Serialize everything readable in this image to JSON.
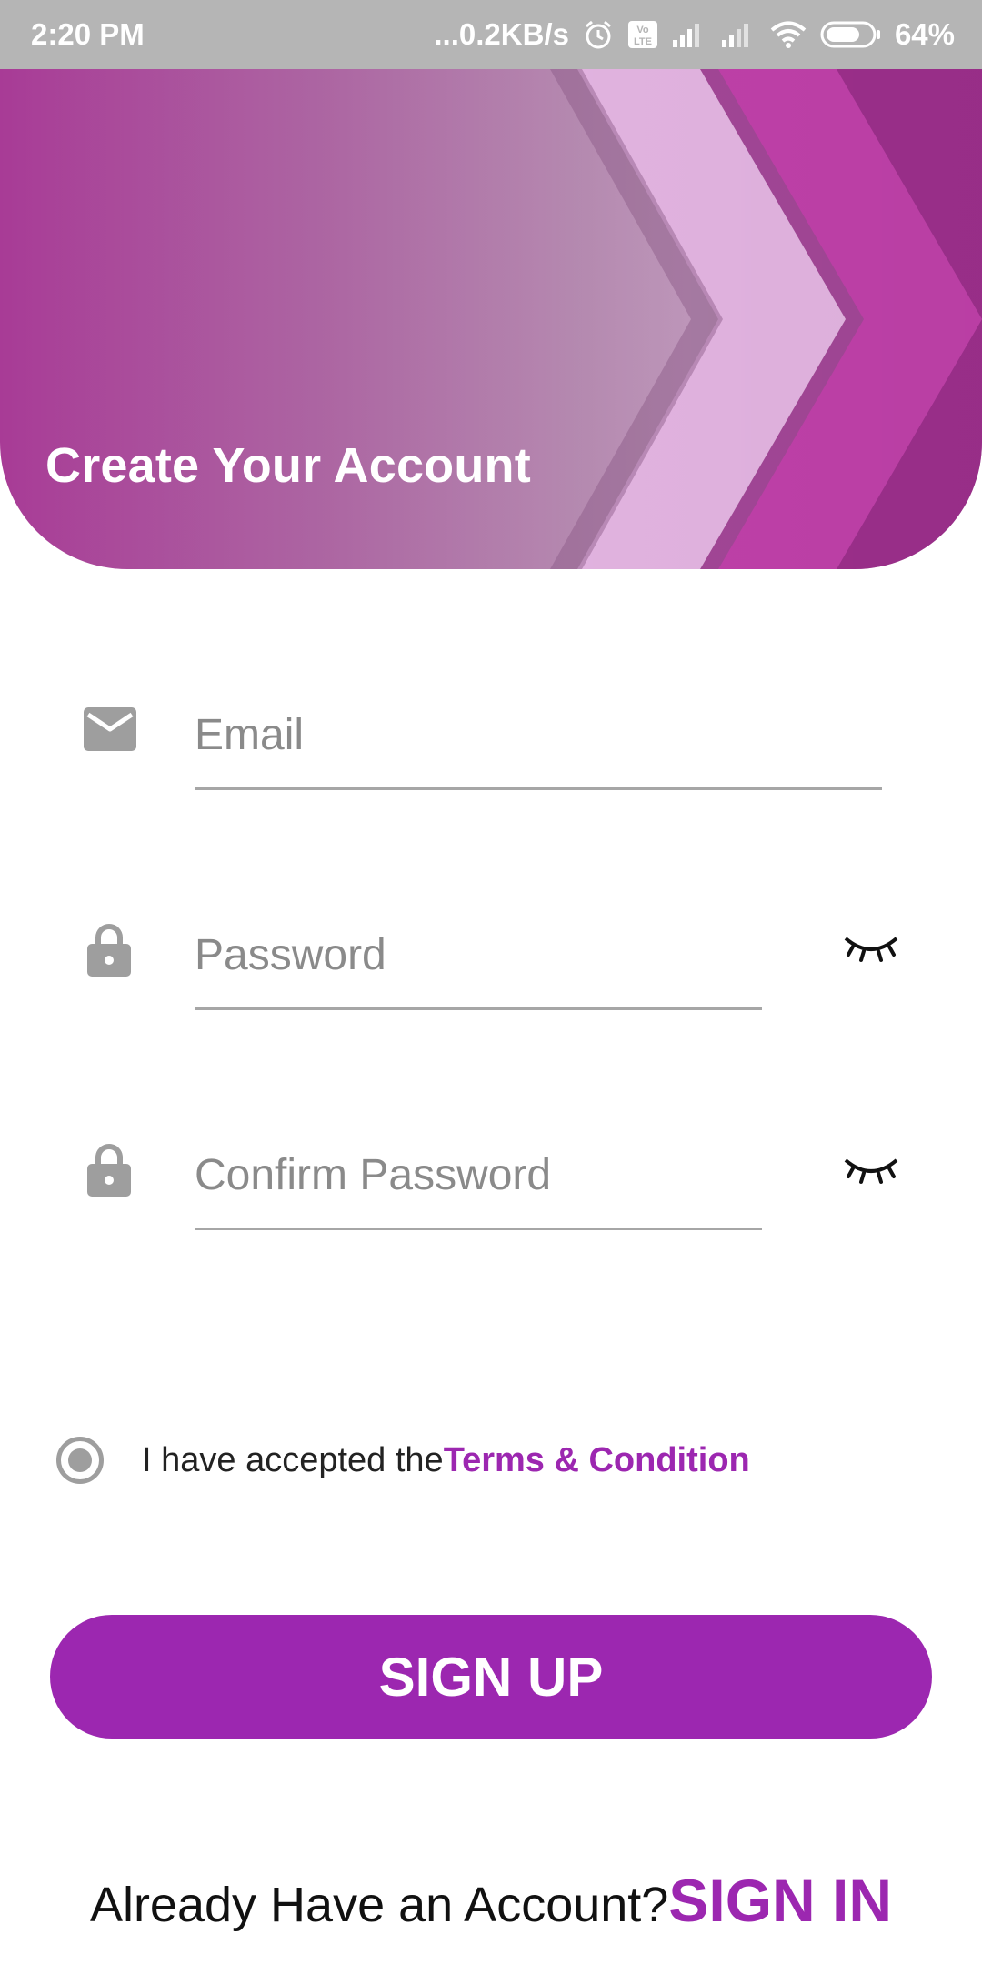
{
  "status_bar": {
    "time": "2:20 PM",
    "network_speed": "...0.2KB/s",
    "battery": "64%",
    "icons": [
      "alarm-icon",
      "volte-icon",
      "signal-icon",
      "signal-icon",
      "wifi-icon",
      "battery-icon"
    ]
  },
  "header": {
    "title": "Create Your Account"
  },
  "form": {
    "email": {
      "placeholder": "Email",
      "value": "",
      "icon": "mail-icon"
    },
    "password": {
      "placeholder": "Password",
      "value": "",
      "icon": "lock-icon",
      "toggle_icon": "eye-closed-icon"
    },
    "confirm_password": {
      "placeholder": "Confirm Password",
      "value": "",
      "icon": "lock-icon",
      "toggle_icon": "eye-closed-icon"
    }
  },
  "terms": {
    "text": "I have accepted the",
    "link": "Terms & Condition",
    "checked": true
  },
  "signup_button": {
    "label": "SIGN UP"
  },
  "signin": {
    "text": "Already Have an Account?",
    "link": "SIGN IN"
  },
  "colors": {
    "accent": "#9c27b0",
    "status_bar": "#b5b5b5",
    "icon_gray": "#9e9e9e",
    "underline": "#a6a6a6"
  }
}
